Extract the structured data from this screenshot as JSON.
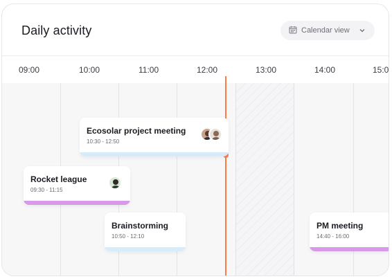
{
  "header": {
    "title": "Daily activity",
    "view_button": {
      "label": "Calendar view",
      "icon": "calendar-icon",
      "chevron": "chevron-down-icon"
    }
  },
  "timeline": {
    "hours": [
      "09:00",
      "10:00",
      "11:00",
      "12:00",
      "13:00",
      "14:00",
      "15:0"
    ],
    "current_time_indicator": true,
    "unavailable_slot": "12:30 - 13:30"
  },
  "events": [
    {
      "title": "Ecosolar project meeting",
      "time": "10:30 - 12:50",
      "color": "#d6ecfa",
      "participants": 2
    },
    {
      "title": "Rocket league",
      "time": "09:30 - 11:15",
      "color": "#d69ae8",
      "participants": 1
    },
    {
      "title": "Brainstorming",
      "time": "10:50 - 12:10",
      "color": "#d6ecfa",
      "participants": 0
    },
    {
      "title": "PM meeting",
      "time": "14:40 - 16:00",
      "color": "#d69ae8",
      "participants": 0
    }
  ],
  "colors": {
    "accent_now": "#ff7a45",
    "blue_bar": "#d6ecfa",
    "purple_bar": "#d69ae8"
  }
}
